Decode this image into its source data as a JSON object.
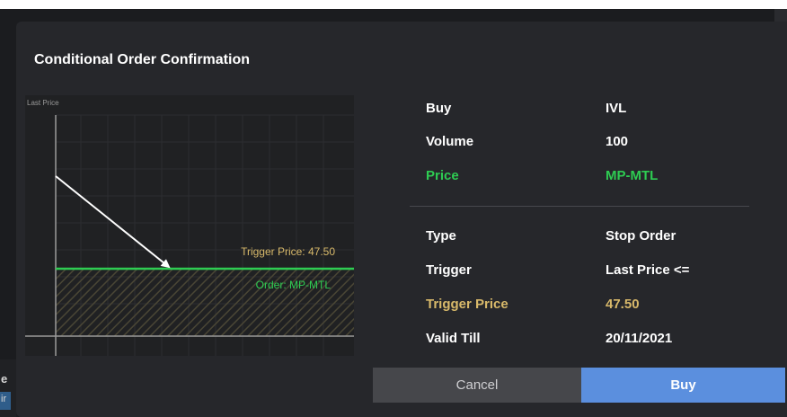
{
  "background": {
    "left_glyph_1": "e",
    "left_glyph_2": "ir"
  },
  "dialog": {
    "title": "Conditional Order Confirmation"
  },
  "chart": {
    "axis_label": "Last Price",
    "trigger_label": "Trigger Price: 47.50",
    "order_label": "Order: MP-MTL",
    "colors": {
      "trigger": "#d8b96a",
      "order": "#2ecc52",
      "arrow": "#ffffff"
    }
  },
  "order_details": [
    {
      "label": "Buy",
      "value": "IVL",
      "style": "normal"
    },
    {
      "label": "Volume",
      "value": "100",
      "style": "normal"
    },
    {
      "label": "Price",
      "value": "MP-MTL",
      "style": "green"
    }
  ],
  "condition_details": [
    {
      "label": "Type",
      "value": "Stop Order",
      "style": "normal"
    },
    {
      "label": "Trigger",
      "value": "Last Price <=",
      "style": "normal"
    },
    {
      "label": "Trigger Price",
      "value": "47.50",
      "style": "gold"
    },
    {
      "label": "Valid Till",
      "value": "20/11/2021",
      "style": "normal"
    }
  ],
  "buttons": {
    "cancel": "Cancel",
    "buy": "Buy"
  }
}
